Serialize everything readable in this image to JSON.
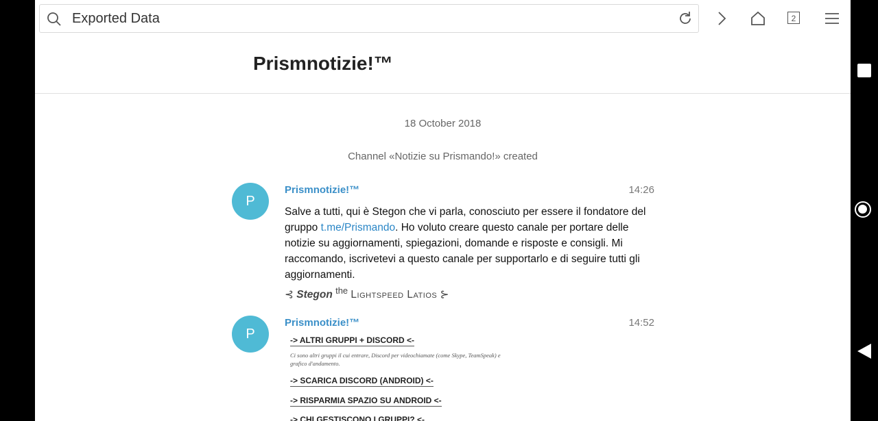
{
  "browser": {
    "url_text": "Exported Data",
    "tab_count": "2"
  },
  "page": {
    "title": "Prismnotizie!™"
  },
  "chat": {
    "date_separator": "18 October 2018",
    "service_message": "Channel «Notizie su Prismando!» created",
    "messages": [
      {
        "avatar_letter": "P",
        "from": "Prismnotizie!™",
        "time": "14:26",
        "text_before_link": "Salve a tutti, qui è Stegon che vi parla, conosciuto per essere il fondatore del gruppo ",
        "link": "t.me/Prismando",
        "text_after_link": ". Ho voluto creare questo canale per portare delle notizie su aggiornamenti, spiegazioni, domande e risposte e consigli. Mi raccomando, iscrivetevi a questo canale per supportarlo e di seguire tutti gli aggiornamenti.",
        "signature_pre": "⊰ ",
        "signature_name": "Stegon",
        "signature_the": "the",
        "signature_title": "Lightspeed Latios",
        "signature_post": " ⊱"
      },
      {
        "avatar_letter": "P",
        "from": "Prismnotizie!™",
        "time": "14:52",
        "image_lines": {
          "line1": "-> ALTRI GRUPPI + DISCORD <-",
          "note": "Ci sono altri gruppi il cui entrare, Discord per videochiamate (come Skype, TeamSpeak) e grafico d'andamento.",
          "line2": "-> SCARICA DISCORD (ANDROID) <-",
          "line3": "-> RISPARMIA SPAZIO SU ANDROID <-",
          "line4": "-> CHI GESTISCONO I GRUPPI? <-"
        }
      }
    ]
  },
  "colors": {
    "avatar": "#4fbad5",
    "sender_name": "#3a8fc8",
    "link": "#2a86c6"
  },
  "icons": [
    "search-icon",
    "reload-icon",
    "forward-icon",
    "home-icon",
    "tabs-icon",
    "menu-icon"
  ]
}
